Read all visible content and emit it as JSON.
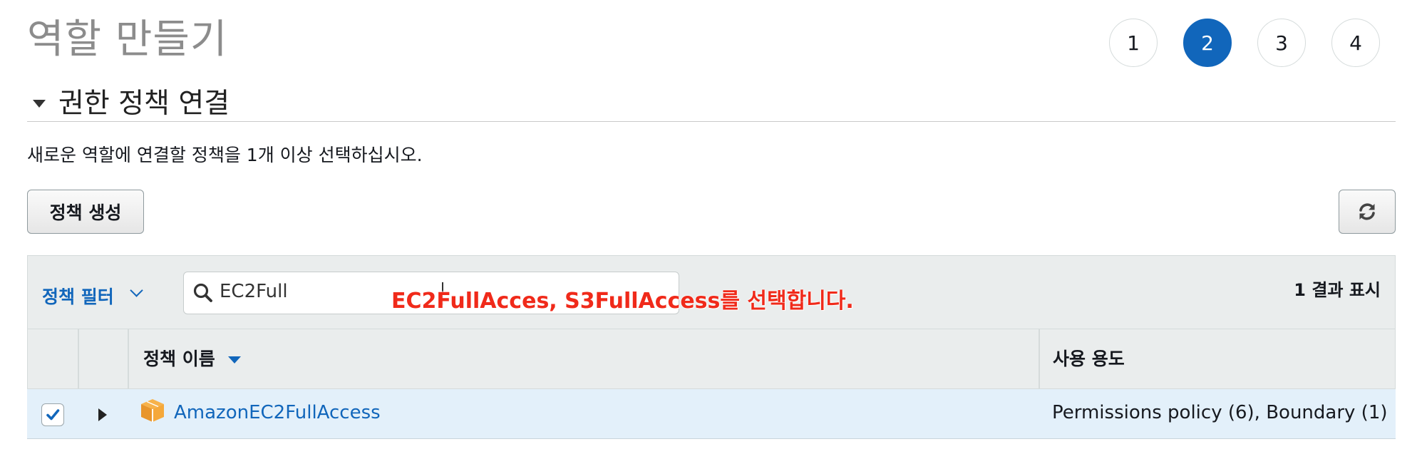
{
  "page": {
    "title": "역할 만들기"
  },
  "steps": [
    "1",
    "2",
    "3",
    "4"
  ],
  "active_step": "2",
  "section": {
    "title": "권한 정책 연결",
    "description": "새로운 역할에 연결할 정책을 1개 이상 선택하십시오."
  },
  "toolbar": {
    "create_policy_label": "정책 생성"
  },
  "filter": {
    "label": "정책 필터",
    "search_value": "EC2Full",
    "result_count": "1 결과 표시"
  },
  "annotation": {
    "text": "EC2FullAcces, S3FullAccess를 선택합니다."
  },
  "table": {
    "columns": {
      "name": "정책 이름",
      "usage": "사용 용도"
    },
    "rows": [
      {
        "name": "AmazonEC2FullAccess",
        "usage": "Permissions policy (6), Boundary (1)",
        "checked": true
      }
    ]
  },
  "colors": {
    "accent": "#1166bb",
    "annotation": "#f02a1a",
    "row_selected": "#e3f0fa"
  }
}
